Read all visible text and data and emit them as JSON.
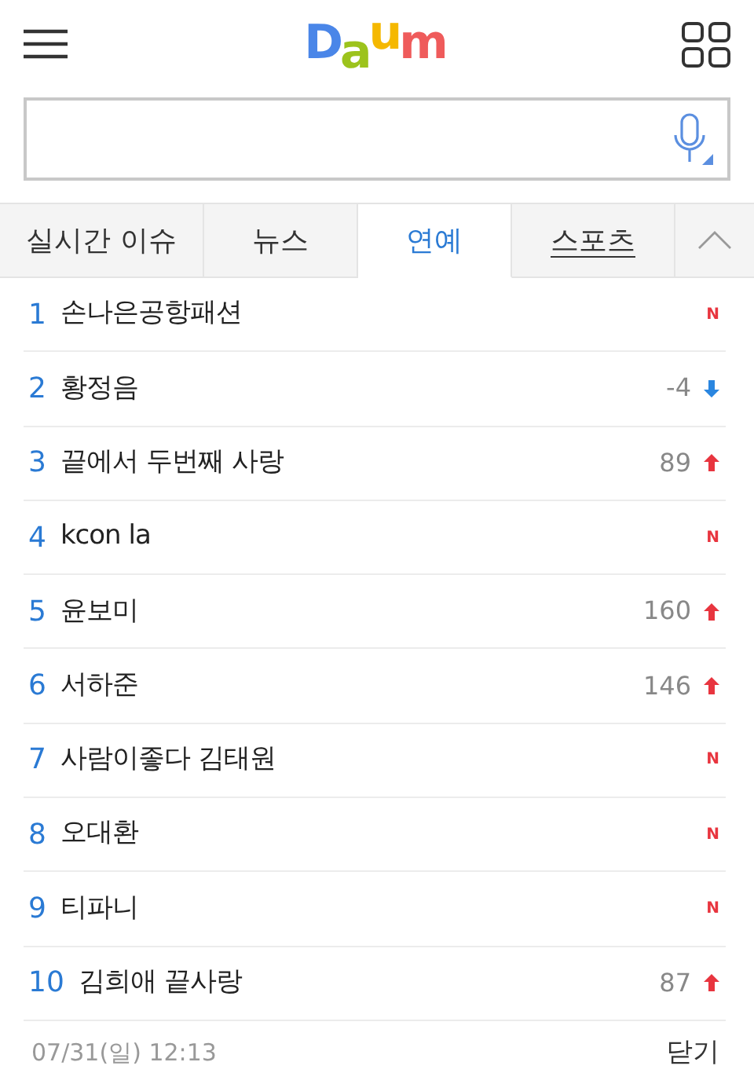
{
  "header": {
    "logo": "Daum"
  },
  "search": {
    "kind": "voice"
  },
  "tabs": [
    {
      "label": "실시간 이슈",
      "selected": false,
      "underlined": false
    },
    {
      "label": "뉴스",
      "selected": false,
      "underlined": false
    },
    {
      "label": "연예",
      "selected": true,
      "underlined": false
    },
    {
      "label": "스포츠",
      "selected": false,
      "underlined": true
    }
  ],
  "ranking": [
    {
      "rank": "1",
      "title": "손나은공항패션",
      "kind": "new",
      "badge": "N"
    },
    {
      "rank": "2",
      "title": "황정음",
      "kind": "down",
      "change": "-4"
    },
    {
      "rank": "3",
      "title": "끝에서 두번째 사랑",
      "kind": "up",
      "change": "89"
    },
    {
      "rank": "4",
      "title": "kcon la",
      "kind": "new",
      "badge": "N"
    },
    {
      "rank": "5",
      "title": "윤보미",
      "kind": "up",
      "change": "160"
    },
    {
      "rank": "6",
      "title": "서하준",
      "kind": "up",
      "change": "146"
    },
    {
      "rank": "7",
      "title": "사람이좋다 김태원",
      "kind": "new",
      "badge": "N"
    },
    {
      "rank": "8",
      "title": "오대환",
      "kind": "new",
      "badge": "N"
    },
    {
      "rank": "9",
      "title": "티파니",
      "kind": "new",
      "badge": "N"
    },
    {
      "rank": "10",
      "title": "김희애 끝사랑",
      "kind": "up",
      "change": "87"
    }
  ],
  "footer": {
    "timestamp": "07/31(일) 12:13",
    "close": "닫기"
  }
}
